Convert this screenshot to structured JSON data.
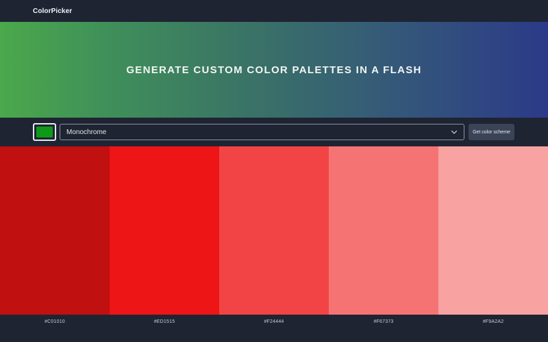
{
  "navbar": {
    "brand": "ColorPicker"
  },
  "hero": {
    "title": "Generate custom color palettes in a flash"
  },
  "controls": {
    "seed_color": "#0E9A18",
    "mode_value": "Monochrome",
    "button_label": "Get color scheme",
    "chevron_icon": "chevron-down-icon"
  },
  "palette": {
    "colors": [
      "#C01010",
      "#ED1515",
      "#F24444",
      "#F67373",
      "#F9A2A2"
    ],
    "labels": [
      "#C01010",
      "#ED1515",
      "#F24444",
      "#F67373",
      "#F9A2A2"
    ]
  }
}
